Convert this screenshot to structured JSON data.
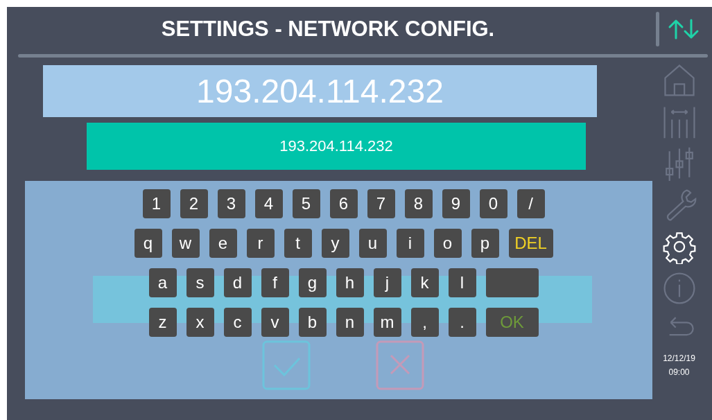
{
  "header": {
    "title": "SETTINGS - NETWORK CONFIG."
  },
  "address_display": {
    "value": "193.204.114.232"
  },
  "address_input": {
    "value": "193.204.114.232"
  },
  "keyboard": {
    "rows": [
      [
        {
          "kind": "char",
          "label": "1"
        },
        {
          "kind": "char",
          "label": "2"
        },
        {
          "kind": "char",
          "label": "3"
        },
        {
          "kind": "char",
          "label": "4"
        },
        {
          "kind": "char",
          "label": "5"
        },
        {
          "kind": "char",
          "label": "6"
        },
        {
          "kind": "char",
          "label": "7"
        },
        {
          "kind": "char",
          "label": "8"
        },
        {
          "kind": "char",
          "label": "9"
        },
        {
          "kind": "char",
          "label": "0"
        },
        {
          "kind": "char",
          "label": "/"
        }
      ],
      [
        {
          "kind": "char",
          "label": "q"
        },
        {
          "kind": "char",
          "label": "w"
        },
        {
          "kind": "char",
          "label": "e"
        },
        {
          "kind": "char",
          "label": "r"
        },
        {
          "kind": "char",
          "label": "t"
        },
        {
          "kind": "char",
          "label": "y"
        },
        {
          "kind": "char",
          "label": "u"
        },
        {
          "kind": "char",
          "label": "i"
        },
        {
          "kind": "char",
          "label": "o"
        },
        {
          "kind": "char",
          "label": "p"
        },
        {
          "kind": "delete",
          "label": "DEL"
        }
      ],
      [
        {
          "kind": "char",
          "label": "a"
        },
        {
          "kind": "char",
          "label": "s"
        },
        {
          "kind": "char",
          "label": "d"
        },
        {
          "kind": "char",
          "label": "f"
        },
        {
          "kind": "char",
          "label": "g"
        },
        {
          "kind": "char",
          "label": "h"
        },
        {
          "kind": "char",
          "label": "j"
        },
        {
          "kind": "char",
          "label": "k"
        },
        {
          "kind": "char",
          "label": "l"
        },
        {
          "kind": "space"
        }
      ],
      [
        {
          "kind": "char",
          "label": "z"
        },
        {
          "kind": "char",
          "label": "x"
        },
        {
          "kind": "char",
          "label": "c"
        },
        {
          "kind": "char",
          "label": "v"
        },
        {
          "kind": "char",
          "label": "b"
        },
        {
          "kind": "char",
          "label": "n"
        },
        {
          "kind": "char",
          "label": "m"
        },
        {
          "kind": "char",
          "label": ","
        },
        {
          "kind": "char",
          "label": "."
        },
        {
          "kind": "ok",
          "label": "OK"
        }
      ]
    ]
  },
  "sidebar": {
    "items": [
      {
        "kind": "home",
        "selected": false
      },
      {
        "kind": "bars",
        "selected": false
      },
      {
        "kind": "sliders",
        "selected": false
      },
      {
        "kind": "wrench",
        "selected": false
      },
      {
        "kind": "gear",
        "selected": true
      },
      {
        "kind": "info",
        "selected": false
      },
      {
        "kind": "back",
        "selected": false
      }
    ],
    "date": "12/12/19",
    "time": "09:00"
  }
}
